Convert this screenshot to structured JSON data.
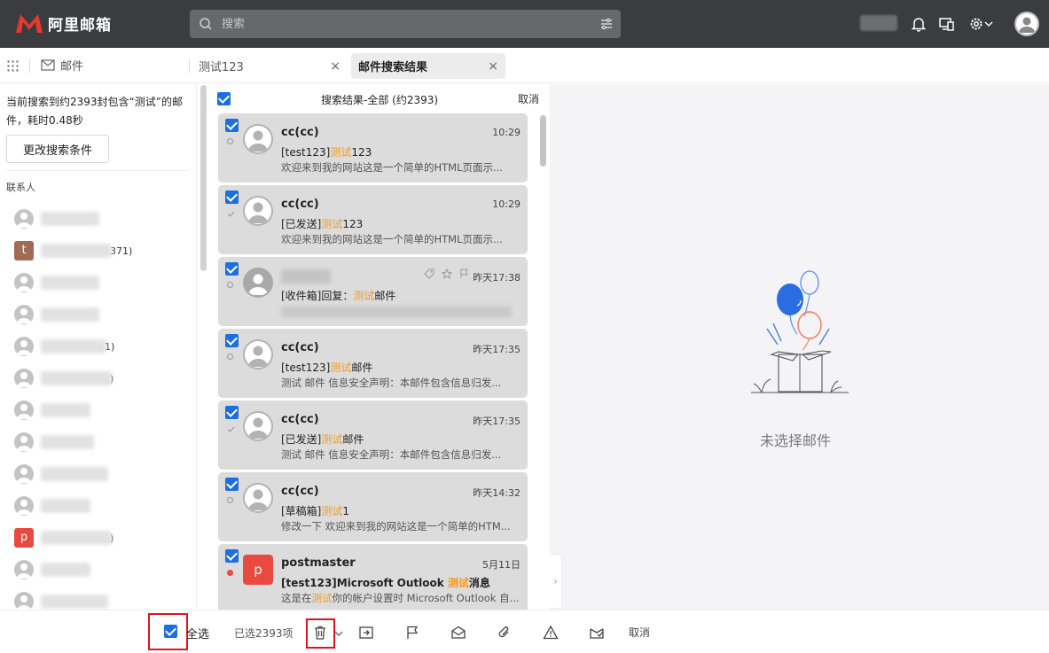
{
  "app": {
    "title": "阿里邮箱"
  },
  "search": {
    "placeholder": "搜索"
  },
  "tabs": {
    "mail_label": "邮件",
    "items": [
      {
        "label": "测试123",
        "close": "×"
      },
      {
        "label": "邮件搜索结果",
        "close": "×"
      }
    ]
  },
  "left": {
    "search_info": "当前搜索到约2393封包含“测试”的邮件，耗时0.48秒",
    "modify_button": "更改搜索条件",
    "contacts_title": "联系人",
    "contacts": [
      {
        "letter": "",
        "suffix": ""
      },
      {
        "letter": "t",
        "suffix": "371)"
      },
      {
        "letter": "",
        "suffix": ""
      },
      {
        "letter": "",
        "suffix": ""
      },
      {
        "letter": "",
        "suffix": "1)"
      },
      {
        "letter": "",
        "suffix": ")"
      },
      {
        "letter": "",
        "suffix": ""
      },
      {
        "letter": "",
        "suffix": ""
      },
      {
        "letter": "",
        "suffix": ""
      },
      {
        "letter": "",
        "suffix": ""
      },
      {
        "letter": "p",
        "suffix": ")"
      },
      {
        "letter": "",
        "suffix": ""
      },
      {
        "letter": "",
        "suffix": ""
      }
    ]
  },
  "list": {
    "title": "搜索结果-全部 (约2393)",
    "cancel": "取消",
    "items": [
      {
        "from": "cc(cc)",
        "time": "10:29",
        "subj_pre": "[test123]",
        "subj_hl": "测试",
        "subj_post": "123",
        "preview": "欢迎来到我的网站这是一个简单的HTML页面示..."
      },
      {
        "from": "cc(cc)",
        "time": "10:29",
        "subj_pre": "[已发送]",
        "subj_hl": "测试",
        "subj_post": "123",
        "preview": "欢迎来到我的网站这是一个简单的HTML页面示..."
      },
      {
        "from": "",
        "time": "昨天17:38",
        "subj_pre": "[收件箱]回复：",
        "subj_hl": "测试",
        "subj_post": "邮件",
        "preview": ""
      },
      {
        "from": "cc(cc)",
        "time": "昨天17:35",
        "subj_pre": "[test123]",
        "subj_hl": "测试",
        "subj_post": "邮件",
        "preview": "测试 邮件 信息安全声明：本邮件包含信息归发..."
      },
      {
        "from": "cc(cc)",
        "time": "昨天17:35",
        "subj_pre": "[已发送]",
        "subj_hl": "测试",
        "subj_post": "邮件",
        "preview": "测试 邮件 信息安全声明：本邮件包含信息归发..."
      },
      {
        "from": "cc(cc)",
        "time": "昨天14:32",
        "subj_pre": "[草稿箱]",
        "subj_hl": "测试",
        "subj_post": "1",
        "preview": "修改一下 欢迎来到我的网站这是一个简单的HTM..."
      },
      {
        "from": "postmaster",
        "time": "5月11日",
        "subj_pre": "[test123]Microsoft Outlook ",
        "subj_hl": "测试",
        "subj_post": "消息",
        "preview_pre": "这是在",
        "preview_hl": "测试",
        "preview_post": "你的帐户设置时 Microsoft Outlook 自...",
        "avatar_letter": "p"
      }
    ]
  },
  "right": {
    "empty_text": "未选择邮件"
  },
  "bottom": {
    "select_all": "全选",
    "selected_count": "已选2393项",
    "cancel": "取消"
  },
  "colors": {
    "accent": "#1c6fe0",
    "highlight": "#f39a1e",
    "brand": "#e94a3f",
    "topbar": "#3a3c3f"
  }
}
